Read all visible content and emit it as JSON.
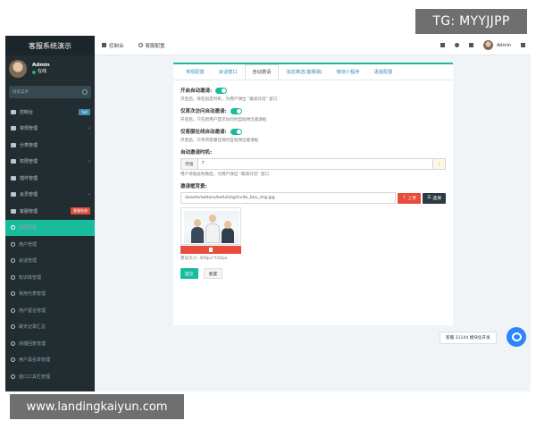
{
  "watermark": {
    "tg": "TG: MYYJJPP",
    "url": "www.landingkaiyun.com"
  },
  "sidebar": {
    "brand": "客服系统演示",
    "user": {
      "name": "Admin",
      "status": "在线"
    },
    "search_placeholder": "搜索菜单",
    "items": [
      {
        "label": "控制台",
        "badge": "hot",
        "badge_color": "#3c8dbc"
      },
      {
        "label": "常规管理",
        "arrow": "‹"
      },
      {
        "label": "分类管理"
      },
      {
        "label": "权限管理",
        "arrow": "‹"
      },
      {
        "label": "插件管理"
      },
      {
        "label": "会员管理",
        "arrow": "‹"
      },
      {
        "label": "客服管理",
        "badge": "客服系统",
        "badge_color": "#dd4b39"
      },
      {
        "label": "客服配置",
        "active": true
      },
      {
        "label": "用户管理"
      },
      {
        "label": "会话管理"
      },
      {
        "label": "知识库管理"
      },
      {
        "label": "常用代表管理"
      },
      {
        "label": "用户留言管理"
      },
      {
        "label": "聊天记录汇总"
      },
      {
        "label": "快捷回复管理"
      },
      {
        "label": "用户黑名单管理"
      },
      {
        "label": "窗口工具栏管理"
      }
    ]
  },
  "topbar": {
    "tabs": [
      {
        "label": "控制台",
        "icon": "dashboard-icon"
      },
      {
        "label": "客服配置",
        "icon": "circle-icon"
      }
    ],
    "user_name": "Admin"
  },
  "panel": {
    "tabs": [
      "常规配置",
      "会话窗口",
      "自动邀请",
      "消息推送(客服端)",
      "微信小程序",
      "语音配置"
    ],
    "active_tab": 2,
    "fields": {
      "auto_invite": {
        "label": "开启自动邀请:",
        "help": "开启后，将在指定时机，为用户弹出 \"邀请对话\" 窗口"
      },
      "first_visit": {
        "label": "仅首次访问自动邀请:",
        "help": "开启后，只在新用户首次访问时自动弹出邀请框"
      },
      "online_only": {
        "label": "仅客服在线自动邀请:",
        "help": "开启后，只有有客服在线时自动弹出邀请框"
      },
      "timing": {
        "label": "自动邀请时机:",
        "addon": "停留",
        "value": "7",
        "help": "用户停留此秒数后，为用户弹出 \"邀请对话\" 窗口"
      },
      "bg": {
        "label": "邀请框背景:",
        "value": "/assets/addons/kefu/img/invite_box_img.jpg",
        "upload_label": "上传",
        "choose_label": "选择",
        "size_hint": "建议大小: 400px*150px"
      }
    },
    "submit_label": "提交",
    "reset_label": "重置"
  },
  "chat": {
    "bubble": "客服 31144 模块化开发"
  }
}
